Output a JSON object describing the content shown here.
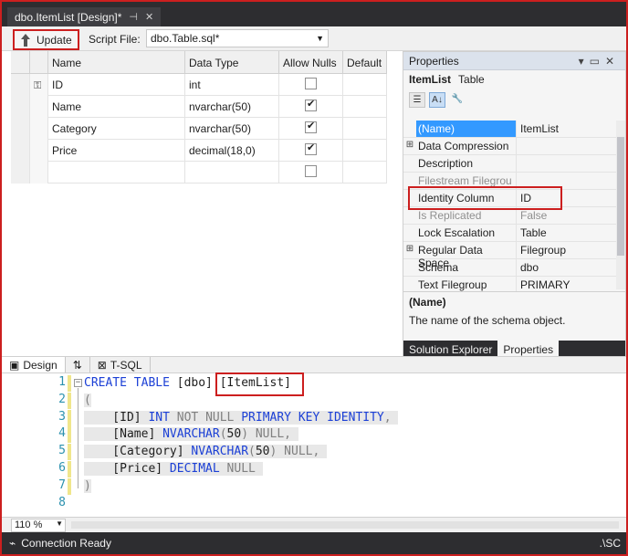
{
  "document_tab": {
    "title": "dbo.ItemList [Design]*",
    "pin_icon": "pin-icon",
    "close_icon": "close-icon"
  },
  "toolbar": {
    "update_label": "Update",
    "script_file_label": "Script File:",
    "script_file_value": "dbo.Table.sql*"
  },
  "grid": {
    "headers": [
      "Name",
      "Data Type",
      "Allow Nulls",
      "Default"
    ],
    "rows": [
      {
        "key": true,
        "name": "ID",
        "type": "int",
        "allow_nulls": false
      },
      {
        "key": false,
        "name": "Name",
        "type": "nvarchar(50)",
        "allow_nulls": true
      },
      {
        "key": false,
        "name": "Category",
        "type": "nvarchar(50)",
        "allow_nulls": true
      },
      {
        "key": false,
        "name": "Price",
        "type": "decimal(18,0)",
        "allow_nulls": true
      },
      {
        "key": false,
        "name": "",
        "type": "",
        "allow_nulls": false
      }
    ]
  },
  "properties": {
    "title": "Properties",
    "object_name": "ItemList",
    "object_type": "Table",
    "rows": [
      {
        "expand": "",
        "name": "(Name)",
        "value": "ItemList",
        "selected": true,
        "dim": false
      },
      {
        "expand": "⊞",
        "name": "Data Compression",
        "value": "",
        "selected": false,
        "dim": false
      },
      {
        "expand": "",
        "name": "Description",
        "value": "",
        "selected": false,
        "dim": false
      },
      {
        "expand": "",
        "name": "Filestream Filegrou",
        "value": "",
        "selected": false,
        "dim": true
      },
      {
        "expand": "",
        "name": "Identity Column",
        "value": "ID",
        "selected": false,
        "dim": false
      },
      {
        "expand": "",
        "name": "Is Replicated",
        "value": "False",
        "selected": false,
        "dim": true
      },
      {
        "expand": "",
        "name": "Lock Escalation",
        "value": "Table",
        "selected": false,
        "dim": false
      },
      {
        "expand": "⊞",
        "name": "Regular Data Space",
        "value": "Filegroup",
        "selected": false,
        "dim": false
      },
      {
        "expand": "",
        "name": "Schema",
        "value": "dbo",
        "selected": false,
        "dim": false
      },
      {
        "expand": "",
        "name": "Text Filegroup",
        "value": "PRIMARY",
        "selected": false,
        "dim": false
      }
    ],
    "desc_title": "(Name)",
    "desc_text": "The name of the schema object.",
    "tabs": [
      "Solution Explorer",
      "Properties"
    ]
  },
  "view_tabs": {
    "design": "Design",
    "swap": "⇅",
    "tsql": "T-SQL"
  },
  "code": {
    "line_numbers": [
      "1",
      "2",
      "3",
      "4",
      "5",
      "6",
      "7",
      "8"
    ]
  },
  "zoom": "110 %",
  "status": {
    "text": "Connection Ready",
    "right": ".\\SC"
  },
  "colors": {
    "accent_red": "#cc1f1f",
    "keyword_blue": "#1c40d6",
    "selection_blue": "#3399ff"
  }
}
